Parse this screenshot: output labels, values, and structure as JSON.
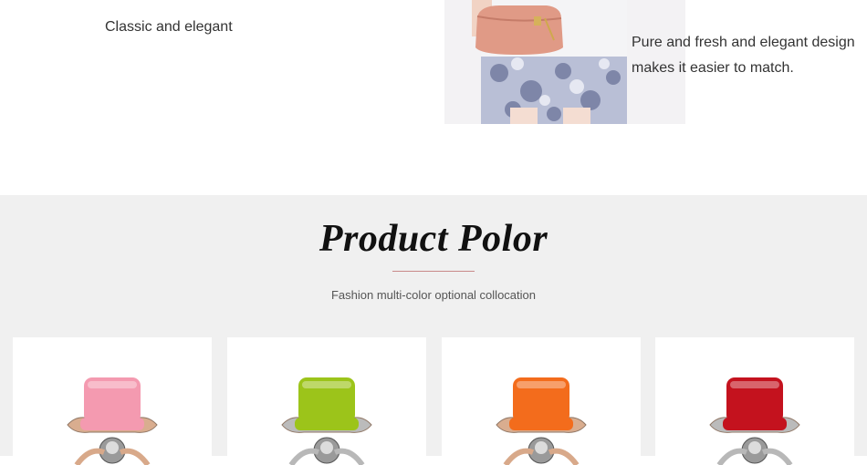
{
  "top": {
    "left_caption": "Classic and elegant",
    "right_caption_line1": "Pure and fresh and elegant design",
    "right_caption_line2": "makes it easier to match."
  },
  "color_section": {
    "title": "Product Polor",
    "subtitle": "Fashion multi-color optional collocation",
    "accent_rule_color": "#c98a8a",
    "products": [
      {
        "seat_color": "#f49ab0",
        "base_tone": "#d8a98a",
        "name": "pink-chair"
      },
      {
        "seat_color": "#9cc41a",
        "base_tone": "#b8b8b8",
        "name": "green-chair"
      },
      {
        "seat_color": "#f36c1c",
        "base_tone": "#d8a98a",
        "name": "orange-chair"
      },
      {
        "seat_color": "#c4121e",
        "base_tone": "#b8b8b8",
        "name": "red-chair"
      }
    ]
  }
}
